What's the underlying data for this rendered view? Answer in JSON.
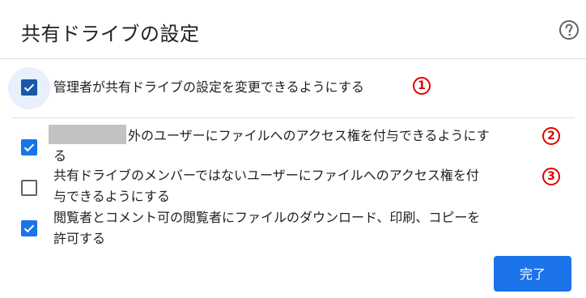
{
  "dialog": {
    "title": "共有ドライブの設定",
    "help_icon": "help-circle-icon",
    "master_option": {
      "label": "管理者が共有ドライブの設定を変更できるようにする",
      "checked": true,
      "marker": "1"
    },
    "options": [
      {
        "label_line1": "外のユーザーにファイルへのアクセス権を付与できるようにす",
        "label_line2": "る",
        "checked": true,
        "marker": "2"
      },
      {
        "label_line1": "共有ドライブのメンバーではないユーザーにファイルへのアクセス権を付",
        "label_line2": "与できるようにする",
        "checked": false,
        "marker": "3"
      },
      {
        "label_line1": "閲覧者とコメント可の閲覧者にファイルのダウンロード、印刷、コピーを",
        "label_line2": "許可する",
        "checked": true,
        "marker": ""
      }
    ],
    "done_button": "完了",
    "colors": {
      "accent": "#1a73e8",
      "marker": "#e00000"
    }
  }
}
